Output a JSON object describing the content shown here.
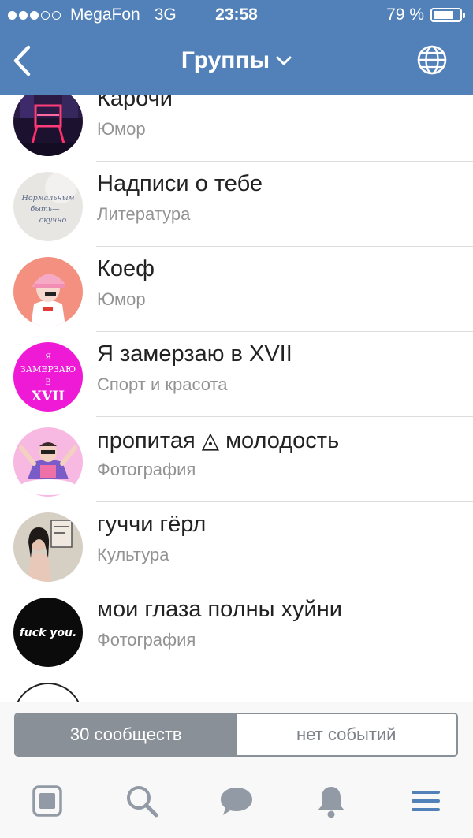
{
  "status_bar": {
    "carrier": "MegaFon",
    "network": "3G",
    "time": "23:58",
    "battery_percent": "79 %",
    "battery_level": 0.79,
    "signal_bars_filled": 3,
    "signal_bars_total": 5
  },
  "nav": {
    "title": "Группы",
    "back_icon": "chevron-left-icon",
    "dropdown_icon": "chevron-down-icon",
    "globe_icon": "globe-icon"
  },
  "groups": [
    {
      "title": "Карочи",
      "category": "Юмор"
    },
    {
      "title": "Надписи о тебе",
      "category": "Литература"
    },
    {
      "title": "Коеф",
      "category": "Юмор"
    },
    {
      "title": "Я замерзаю в XVII",
      "category": "Спорт и красота"
    },
    {
      "title": "пропитая ◬ молодость",
      "category": "Фотография"
    },
    {
      "title": "гуччи гёрл",
      "category": "Культура"
    },
    {
      "title": "мои глаза полны хуйни",
      "category": "Фотография"
    }
  ],
  "avatar_text": {
    "nadpisi": [
      "Нормальным",
      "быть—",
      "скучно"
    ],
    "zamerzayu": [
      "Я",
      "ЗАМЕРЗАЮ",
      "В",
      "XVII"
    ],
    "glaza": "fuck you."
  },
  "segmented": {
    "left": "30 сообществ",
    "right": "нет событий",
    "active": "left"
  },
  "tabbar": {
    "items": [
      "news-icon",
      "search-icon",
      "messages-icon",
      "notifications-icon",
      "menu-icon"
    ],
    "active": "menu-icon"
  },
  "colors": {
    "header": "#5181b8",
    "accent": "#5181b8",
    "inactive_icon": "#919aa5"
  }
}
